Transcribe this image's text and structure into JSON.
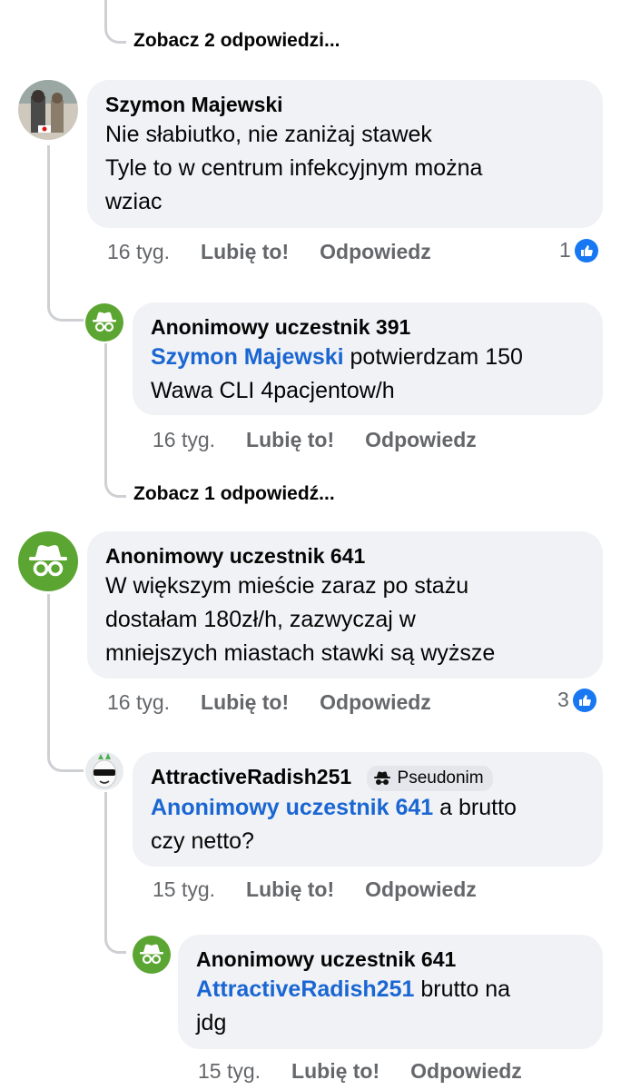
{
  "thread": {
    "top_view_replies": "Zobacz 2 odpowiedzi...",
    "comment1": {
      "author": "Szymon Majewski",
      "lines": [
        "Nie słabiutko, nie zaniżaj stawek",
        "Tyle to w centrum infekcyjnym można",
        "wziac"
      ],
      "time": "16 tyg.",
      "like": "Lubię to!",
      "reply": "Odpowiedz",
      "reactions": "1"
    },
    "reply1": {
      "author": "Anonimowy uczestnik 391",
      "mention": "Szymon Majewski",
      "line1_rest": " potwierdzam 150",
      "line2": "Wawa CLI 4pacjentow/h",
      "time": "16 tyg.",
      "like": "Lubię to!",
      "reply": "Odpowiedz"
    },
    "view_reply_1": "Zobacz 1 odpowiedź...",
    "comment2": {
      "author": "Anonimowy uczestnik 641",
      "lines": [
        "W większym mieście zaraz po stażu",
        "dostałam 180zł/h, zazwyczaj w",
        "mniejszych miastach stawki są wyższe"
      ],
      "time": "16 tyg.",
      "like": "Lubię to!",
      "reply": "Odpowiedz",
      "reactions": "3"
    },
    "reply2": {
      "author": "AttractiveRadish251",
      "badge": "Pseudonim",
      "mention": "Anonimowy uczestnik 641",
      "line1_rest": " a brutto",
      "line2": "czy netto?",
      "time": "15 tyg.",
      "like": "Lubię to!",
      "reply": "Odpowiedz"
    },
    "reply3": {
      "author": "Anonimowy uczestnik 641",
      "mention": "AttractiveRadish251",
      "line1_rest": " brutto na",
      "line2": "jdg",
      "time": "15 tyg.",
      "like": "Lubię to!",
      "reply": "Odpowiedz"
    }
  },
  "colors": {
    "bubble": "#f0f2f5",
    "mention": "#1a66d2",
    "anon_avatar": "#5ba532",
    "like_blue": "#1877f2",
    "muted": "#65676b"
  }
}
